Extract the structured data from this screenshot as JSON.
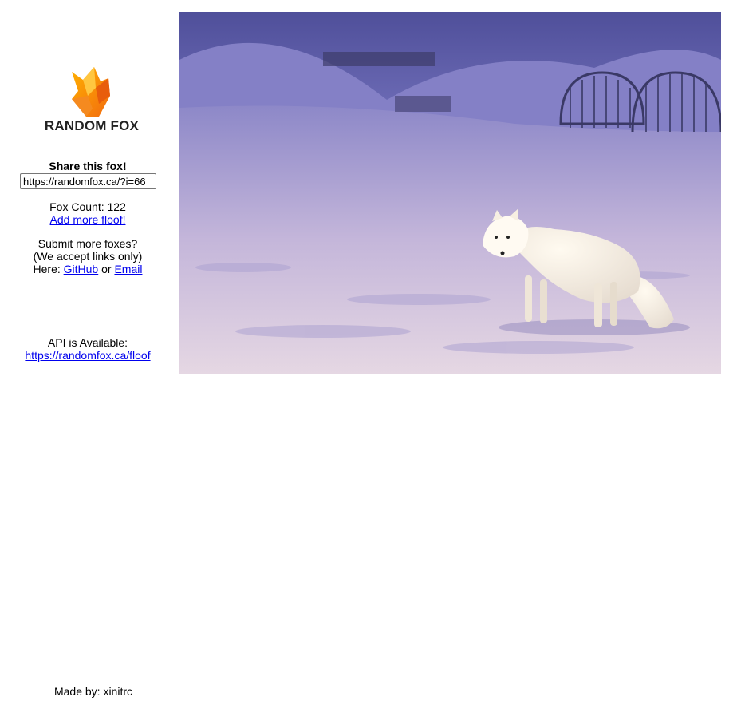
{
  "logo": {
    "text": "RANDOM FOX"
  },
  "share": {
    "title": "Share this fox!",
    "url_value": "https://randomfox.ca/?i=66"
  },
  "count": {
    "label": "Fox Count: 122",
    "add_link": "Add more floof!"
  },
  "submit": {
    "line1": "Submit more foxes?",
    "line2": "(We accept links only)",
    "here": "Here:",
    "github": "GitHub",
    "or": "or",
    "email": "Email"
  },
  "api": {
    "label": "API is Available:",
    "link": "https://randomfox.ca/floof"
  },
  "footer": {
    "text": "Made by: xinitrc"
  },
  "colors": {
    "link": "#0000ee",
    "logo_orange": "#f7931e",
    "snow_sky": "#6a66b8"
  }
}
